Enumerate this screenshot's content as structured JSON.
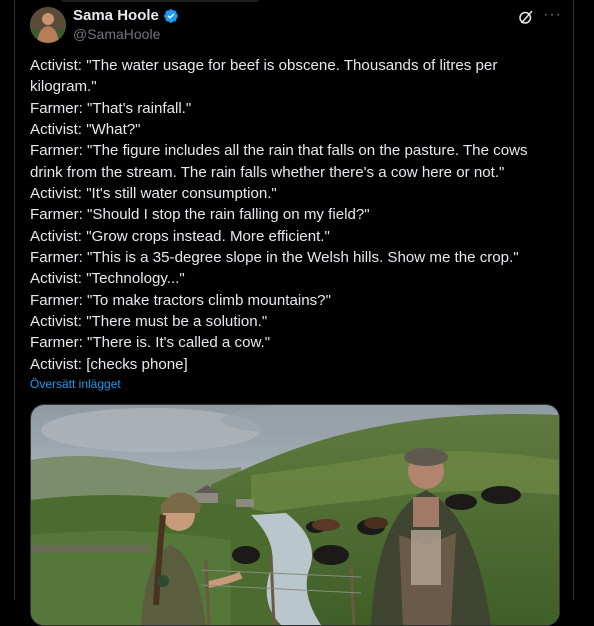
{
  "author": {
    "name": "Sama Hoole",
    "handle": "@SamaHoole",
    "verified": true
  },
  "icons": {
    "verified": "verified-badge-icon",
    "grok": "grok-icon",
    "more": "more-icon"
  },
  "tweet": {
    "lines": [
      "Activist: \"The water usage for beef is obscene. Thousands of litres per",
      "kilogram.\"",
      "Farmer: \"That's rainfall.\"",
      "Activist: \"What?\"",
      "Farmer: \"The figure includes all the rain that falls on the pasture. The cows",
      "drink from the stream. The rain falls whether there's a cow here or not.\"",
      "Activist: \"It's still water consumption.\"",
      "Farmer: \"Should I stop the rain falling on my field?\"",
      "Activist: \"Grow crops instead. More efficient.\"",
      "Farmer: \"This is a 35-degree slope in the Welsh hills. Show me the crop.\"",
      "Activist: \"Technology...\"",
      "Farmer: \"To make tractors climb mountains?\"",
      "Activist: \"There must be a solution.\"",
      "Farmer: \"There is. It's called a cow.\"",
      "Activist: [checks phone]"
    ],
    "translate_label": "Översätt inlägget"
  },
  "colors": {
    "background": "#000000",
    "text": "#e7e9ea",
    "muted": "#71767b",
    "link": "#1d9bf0",
    "verified": "#1d9bf0"
  }
}
